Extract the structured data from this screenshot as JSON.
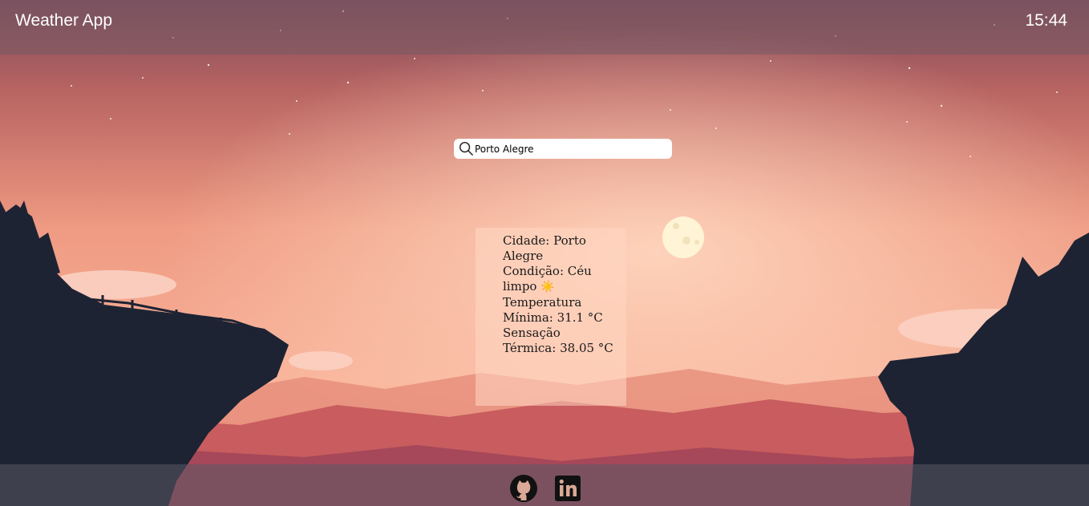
{
  "header": {
    "title": "Weather App",
    "time": "15:44"
  },
  "search": {
    "value": "Porto Alegre",
    "icon": "search-icon"
  },
  "weather": {
    "city_label": "Cidade:",
    "city": "Porto Alegre",
    "condition_label": "Condição:",
    "condition": "Céu limpo",
    "condition_icon": "☀️",
    "min_temp_label": "Temperatura Mínima:",
    "min_temp": "31.1 °C",
    "feels_like_label": "Sensação Térmica:",
    "feels_like": "38.05 °C"
  },
  "footer": {
    "links": [
      {
        "icon": "github-icon"
      },
      {
        "icon": "linkedin-icon"
      }
    ]
  },
  "colors": {
    "header_bg": "#785a64",
    "footer_bg": "#5a5a64",
    "sky_top": "#7a4a58",
    "sky_glow": "#f6a98c",
    "moon": "#fff4d6",
    "silhouette": "#1d2333"
  }
}
